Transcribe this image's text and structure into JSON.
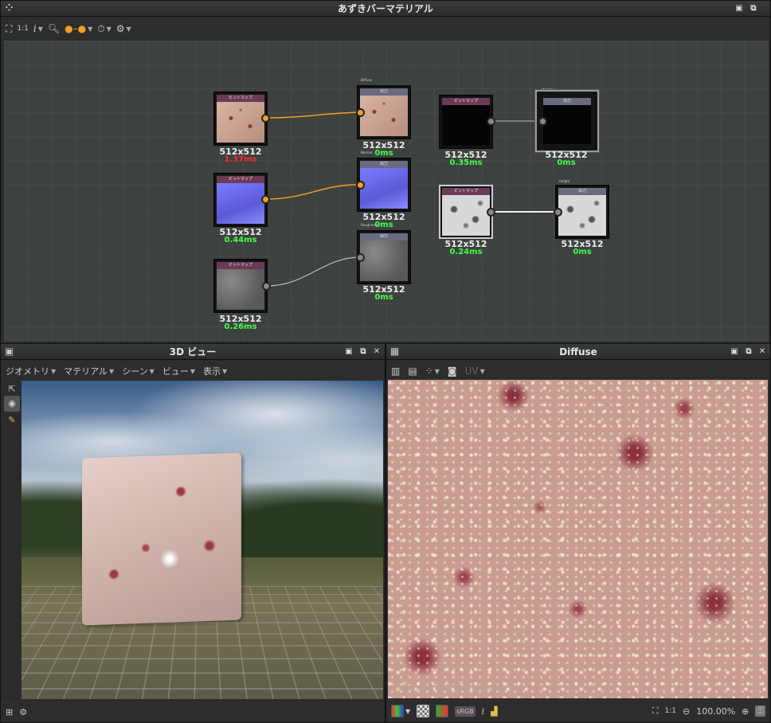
{
  "graph_window": {
    "title": "あずきバーマテリアル",
    "toolbar": {
      "zoom_1_1": "1:1",
      "info": "i"
    }
  },
  "nodes": [
    {
      "header": "ビットマップ",
      "label": "512x512",
      "time": "1.37ms",
      "time_color": "#ff2a2a"
    },
    {
      "header": "ビットマップ",
      "label": "512x512",
      "time": "0.44ms",
      "time_color": "#44ff44"
    },
    {
      "header": "ビットマップ",
      "label": "512x512",
      "time": "0.26ms",
      "time_color": "#44ff44"
    },
    {
      "header": "出力",
      "label": "512x512",
      "time": "0ms",
      "time_color": "#44ff44",
      "tag": "Diffuse"
    },
    {
      "header": "出力",
      "label": "512x512",
      "time": "0ms",
      "time_color": "#44ff44",
      "tag": "Normal"
    },
    {
      "header": "出力",
      "label": "512x512",
      "time": "0ms",
      "time_color": "#44ff44",
      "tag": "Roughness"
    },
    {
      "header": "ビットマップ",
      "label": "512x512",
      "time": "0.35ms",
      "time_color": "#44ff44"
    },
    {
      "header": "出力",
      "label": "512x512",
      "time": "0ms",
      "time_color": "#44ff44",
      "tag": "Metallic"
    },
    {
      "header": "ビットマップ",
      "label": "512x512",
      "time": "0.24ms",
      "time_color": "#44ff44"
    },
    {
      "header": "出力",
      "label": "512x512",
      "time": "0ms",
      "time_color": "#44ff44",
      "tag": "Height"
    }
  ],
  "view3d": {
    "title": "3D ビュー",
    "menu": [
      "ジオメトリ",
      "マテリアル",
      "シーン",
      "ビュー",
      "表示"
    ]
  },
  "diffuse_view": {
    "title": "Diffuse",
    "uv_label": "UV",
    "overlay": "512 x 512 (RGBA, 8bpc)",
    "zoom_ratio": "1:1",
    "zoom_percent": "100.00%",
    "srgb_label": "sRGB",
    "info": "i"
  },
  "colors": {
    "accent_orange": "#f0a020",
    "time_red": "#ff2a2a",
    "time_green": "#44ff44"
  }
}
